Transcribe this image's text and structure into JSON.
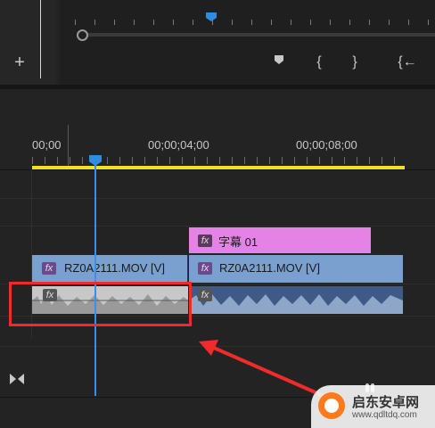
{
  "source_panel": {
    "controls": {
      "add_label": "+",
      "marker_icon": "marker-icon",
      "mark_in_label": "{",
      "mark_out_label": "}",
      "go_to_in_label": "{←"
    }
  },
  "timeline": {
    "timecodes": [
      "00;00",
      "00;00;04;00",
      "00;00;08;00"
    ],
    "tracks": {
      "graphics_clip": {
        "fx": "fx",
        "label": "字幕 01",
        "color": "#e582e5"
      },
      "video_clip_1": {
        "fx": "fx",
        "label": "RZ0A2111.MOV [V]",
        "color": "#7aa0cf"
      },
      "video_clip_2": {
        "fx": "fx",
        "label": "RZ0A2111.MOV [V]",
        "color": "#7aa0cf"
      },
      "audio_clip_1": {
        "fx": "fx",
        "color": "#c8c8c8",
        "selected": true
      },
      "audio_clip_2": {
        "fx": "fx",
        "color": "#3f5a86"
      }
    },
    "work_area_color": "#f0e020",
    "playhead_color": "#3b8fe8"
  },
  "watermark": {
    "name": "启东安卓网",
    "url": "www.qdltdq.com"
  },
  "annotation": {
    "highlight_color": "#ef2b2b"
  }
}
